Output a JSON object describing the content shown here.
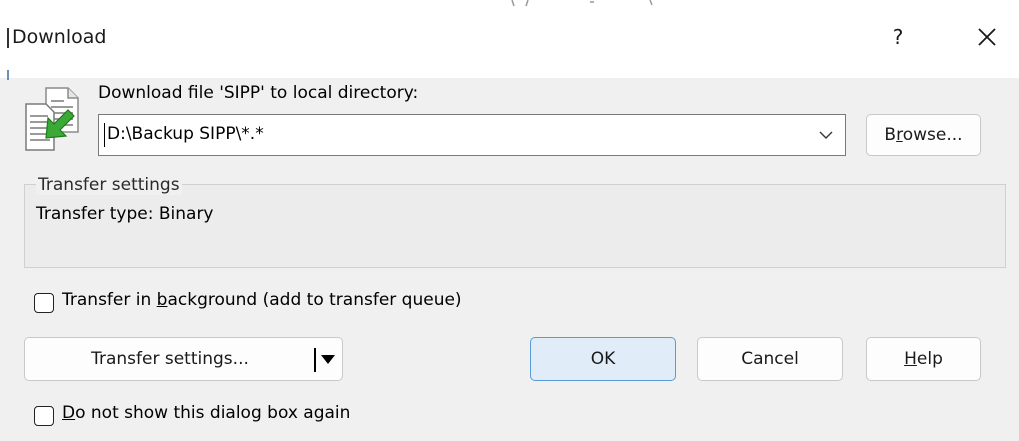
{
  "window": {
    "title": "Download",
    "help_glyph": "?",
    "close_icon": "close-icon"
  },
  "header": {
    "label": "Download file 'SIPP' to local directory:",
    "icon": "file-download-icon"
  },
  "directory": {
    "value": "D:\\Backup SIPP\\*.*",
    "dropdown_icon": "chevron-down-icon"
  },
  "browse": {
    "pre": "B",
    "accel": "r",
    "post": "owse..."
  },
  "transfer_group": {
    "caption": "Transfer settings",
    "type_text": "Transfer type: Binary"
  },
  "background_option": {
    "pre": "Transfer in ",
    "accel": "b",
    "post": "ackground (add to transfer queue)",
    "checked": false
  },
  "buttons": {
    "transfer_settings": "Transfer settings...",
    "ok": "OK",
    "cancel": "Cancel",
    "help_accel": "H",
    "help_post": "elp"
  },
  "dont_show": {
    "accel": "D",
    "post": "o not show this dialog box again",
    "checked": false
  },
  "colors": {
    "ok_border": "#5b9bd5",
    "ok_fill": "#e0ecf8",
    "arrow_green": "#3aa935"
  }
}
